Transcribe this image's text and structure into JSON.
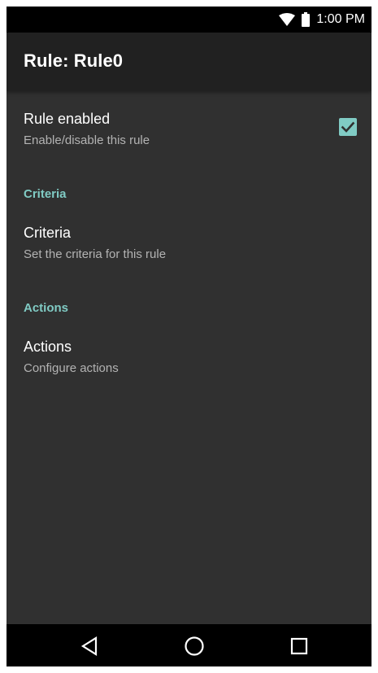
{
  "status_bar": {
    "time": "1:00 PM",
    "icons": [
      "wifi-icon",
      "battery-icon"
    ]
  },
  "app_bar": {
    "title": "Rule: Rule0"
  },
  "preferences": {
    "rule_enabled": {
      "title": "Rule enabled",
      "summary": "Enable/disable this rule",
      "checked": true
    },
    "criteria_category": "Criteria",
    "criteria": {
      "title": "Criteria",
      "summary": "Set the criteria for this rule"
    },
    "actions_category": "Actions",
    "actions": {
      "title": "Actions",
      "summary": "Configure actions"
    }
  },
  "nav_bar": {
    "buttons": [
      "back-icon",
      "home-icon",
      "recents-icon"
    ]
  },
  "colors": {
    "background": "#303030",
    "app_bar": "#212121",
    "accent": "#80cbc4",
    "status_bar": "#000000"
  }
}
